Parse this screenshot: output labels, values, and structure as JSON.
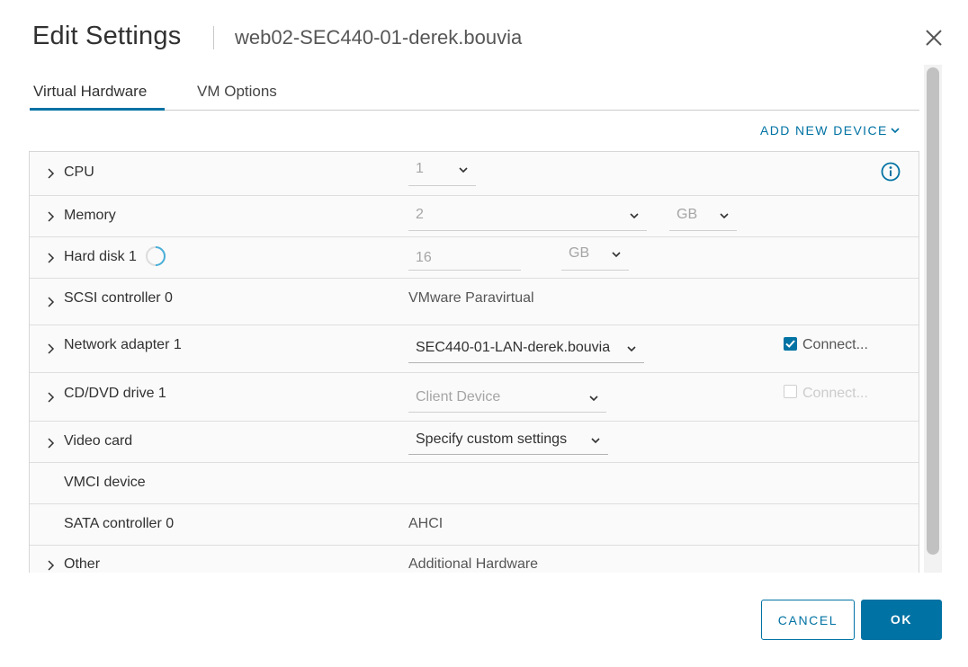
{
  "dialog": {
    "title": "Edit Settings",
    "subtitle": "web02-SEC440-01-derek.bouvia"
  },
  "tabs": [
    {
      "label": "Virtual Hardware",
      "active": true
    },
    {
      "label": "VM Options",
      "active": false
    }
  ],
  "add_new_device": "ADD NEW DEVICE",
  "hardware": {
    "cpu": {
      "label": "CPU",
      "value": "1"
    },
    "memory": {
      "label": "Memory",
      "value": "2",
      "unit": "GB"
    },
    "hard_disk": {
      "label": "Hard disk 1",
      "value": "16",
      "unit": "GB"
    },
    "scsi": {
      "label": "SCSI controller 0",
      "value": "VMware Paravirtual"
    },
    "network": {
      "label": "Network adapter 1",
      "value": "SEC440-01-LAN-derek.bouvia",
      "connect_label": "Connect...",
      "connected": true
    },
    "cdrom": {
      "label": "CD/DVD drive 1",
      "value": "Client Device",
      "connect_label": "Connect...",
      "connected": false
    },
    "video": {
      "label": "Video card",
      "value": "Specify custom settings"
    },
    "vmci": {
      "label": "VMCI device"
    },
    "sata": {
      "label": "SATA controller 0",
      "value": "AHCI"
    },
    "other": {
      "label": "Other",
      "value": "Additional Hardware"
    }
  },
  "buttons": {
    "cancel": "CANCEL",
    "ok": "OK"
  },
  "colors": {
    "accent": "#0072a3",
    "text": "#313131",
    "disabled_text": "#a5a5a5"
  }
}
